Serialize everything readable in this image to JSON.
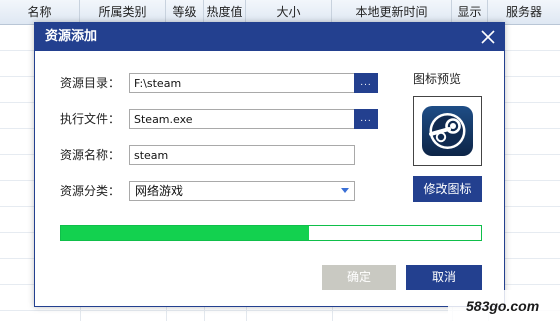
{
  "table": {
    "columns": [
      "名称",
      "所属类别",
      "等级",
      "热度值",
      "大小",
      "本地更新时间",
      "显示",
      "服务器"
    ]
  },
  "dialog": {
    "title": "资源添加",
    "directory_label": "资源目录：",
    "directory_value": "F:\\steam",
    "exe_label": "执行文件：",
    "exe_value": "Steam.exe",
    "name_label": "资源名称：",
    "name_value": "steam",
    "category_label": "资源分类：",
    "category_value": "网络游戏",
    "browse_label": "...",
    "preview_label": "图标预览",
    "change_icon_label": "修改图标",
    "progress_fraction": 0.59,
    "confirm_label": "确定",
    "cancel_label": "取消"
  },
  "icons": {
    "close": "close-icon",
    "browse": "ellipsis-icon",
    "dropdown": "chevron-down-icon",
    "preview": "steam-logo-icon"
  },
  "watermark": {
    "text": "583go.com"
  },
  "colors": {
    "accent": "#23408f",
    "progress": "#13d14f",
    "disabled_button": "#c9c9c2"
  }
}
